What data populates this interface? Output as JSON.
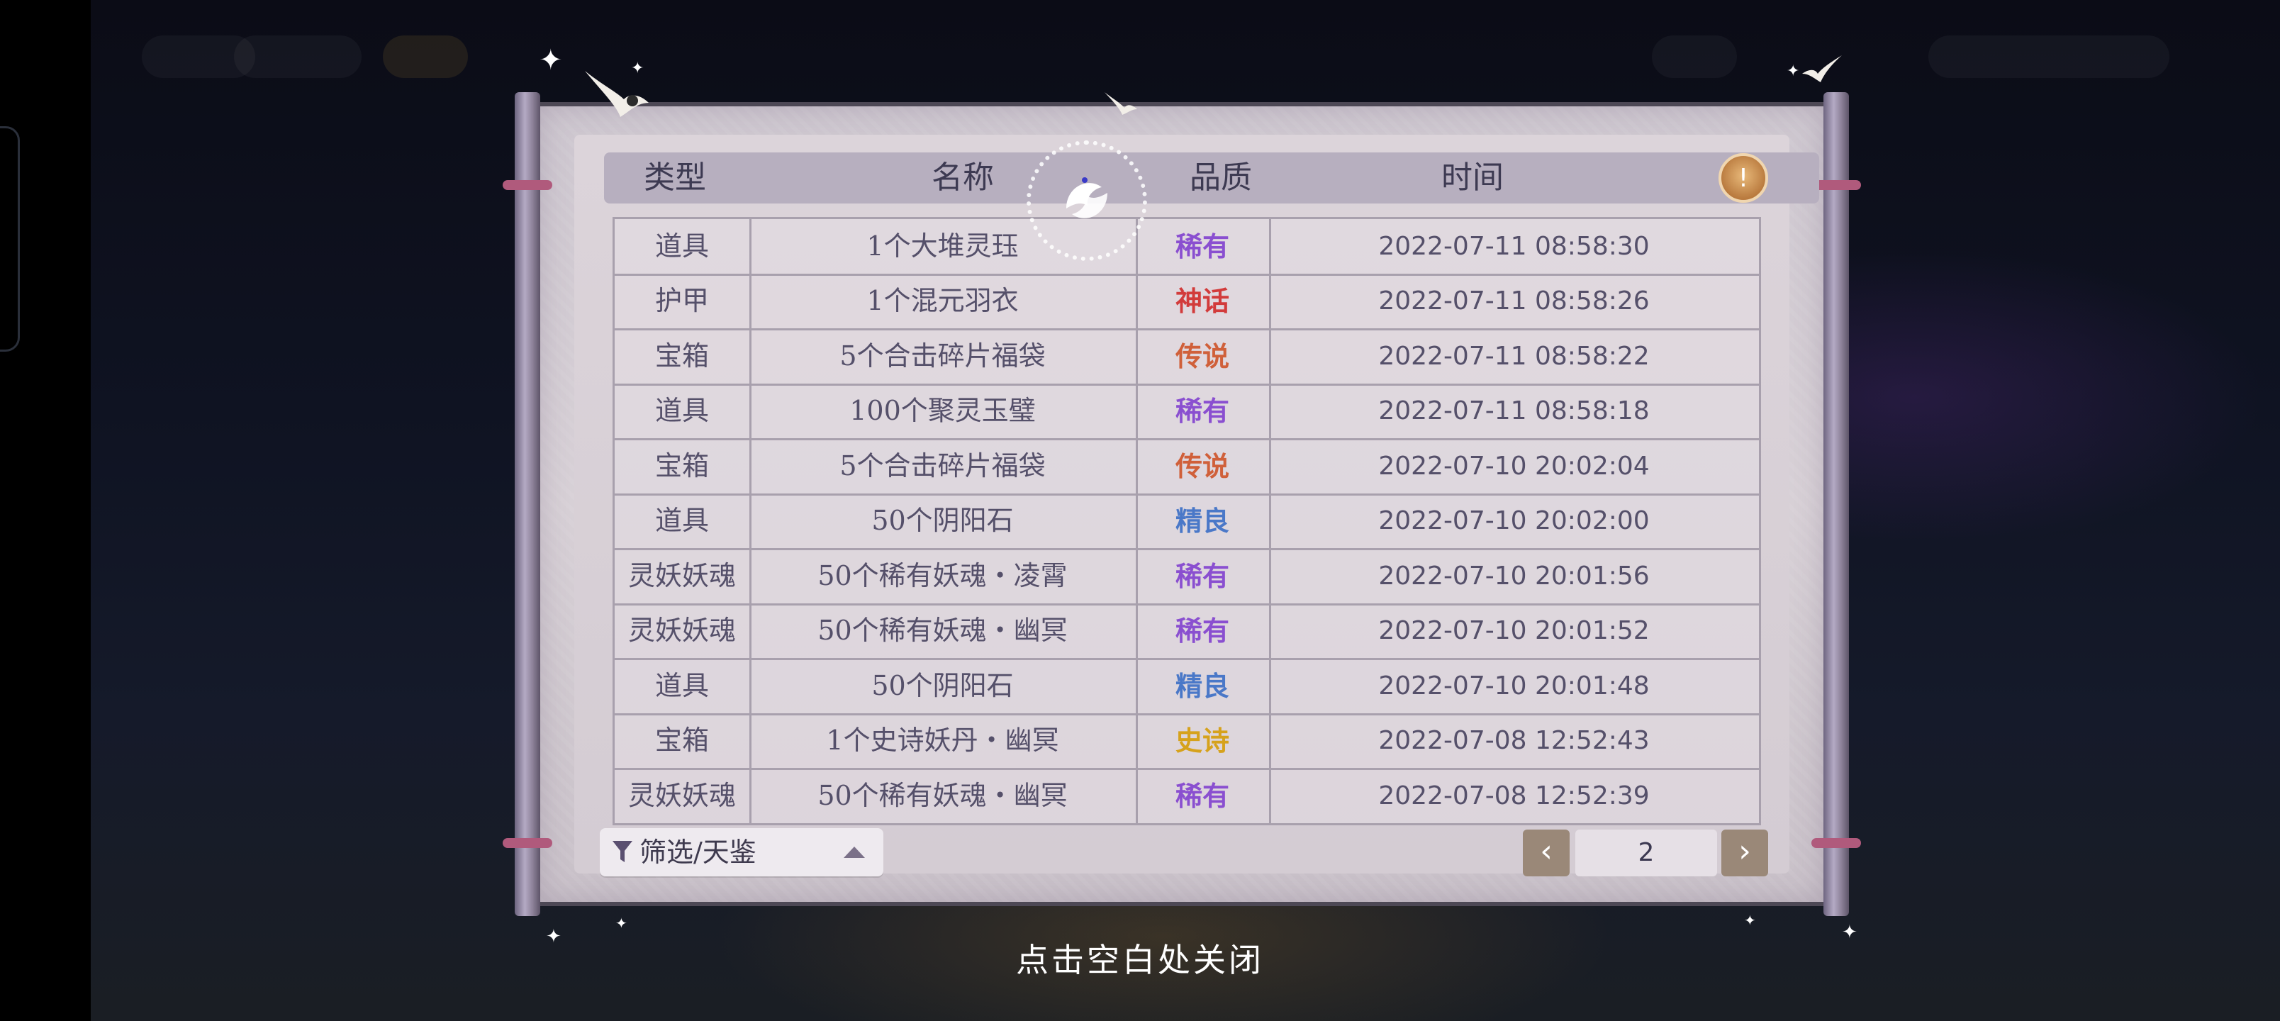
{
  "colors": {
    "quality_rare": "#8a4fd0",
    "quality_myth": "#d23b3b",
    "quality_legend": "#d0603a",
    "quality_fine": "#4a78c8",
    "quality_epic": "#d6a21c"
  },
  "table": {
    "headers": {
      "type": "类型",
      "name": "名称",
      "quality": "品质",
      "time": "时间"
    },
    "rows": [
      {
        "type": "道具",
        "name": "1个大堆灵珏",
        "quality": "稀有",
        "quality_color": "#8a4fd0",
        "time": "2022-07-11  08:58:30"
      },
      {
        "type": "护甲",
        "name": "1个混元羽衣",
        "quality": "神话",
        "quality_color": "#d23b3b",
        "time": "2022-07-11  08:58:26"
      },
      {
        "type": "宝箱",
        "name": "5个合击碎片福袋",
        "quality": "传说",
        "quality_color": "#d0603a",
        "time": "2022-07-11  08:58:22"
      },
      {
        "type": "道具",
        "name": "100个聚灵玉璧",
        "quality": "稀有",
        "quality_color": "#8a4fd0",
        "time": "2022-07-11  08:58:18"
      },
      {
        "type": "宝箱",
        "name": "5个合击碎片福袋",
        "quality": "传说",
        "quality_color": "#d0603a",
        "time": "2022-07-10  20:02:04"
      },
      {
        "type": "道具",
        "name": "50个阴阳石",
        "quality": "精良",
        "quality_color": "#4a78c8",
        "time": "2022-07-10  20:02:00"
      },
      {
        "type": "灵妖妖魂",
        "name": "50个稀有妖魂・凌霄",
        "quality": "稀有",
        "quality_color": "#8a4fd0",
        "time": "2022-07-10  20:01:56"
      },
      {
        "type": "灵妖妖魂",
        "name": "50个稀有妖魂・幽冥",
        "quality": "稀有",
        "quality_color": "#8a4fd0",
        "time": "2022-07-10  20:01:52"
      },
      {
        "type": "道具",
        "name": "50个阴阳石",
        "quality": "精良",
        "quality_color": "#4a78c8",
        "time": "2022-07-10  20:01:48"
      },
      {
        "type": "宝箱",
        "name": "1个史诗妖丹・幽冥",
        "quality": "史诗",
        "quality_color": "#d6a21c",
        "time": "2022-07-08  12:52:43"
      },
      {
        "type": "灵妖妖魂",
        "name": "50个稀有妖魂・幽冥",
        "quality": "稀有",
        "quality_color": "#8a4fd0",
        "time": "2022-07-08  12:52:39"
      }
    ]
  },
  "filter": {
    "label": "筛选/天鉴",
    "icon": "filter-icon"
  },
  "pager": {
    "page": "2",
    "prev_label": "‹",
    "next_label": "›"
  },
  "close_hint": "点击空白处关闭",
  "icons": {
    "hint": "hint-bulb-icon",
    "emblem": "koi-emblem-icon"
  }
}
